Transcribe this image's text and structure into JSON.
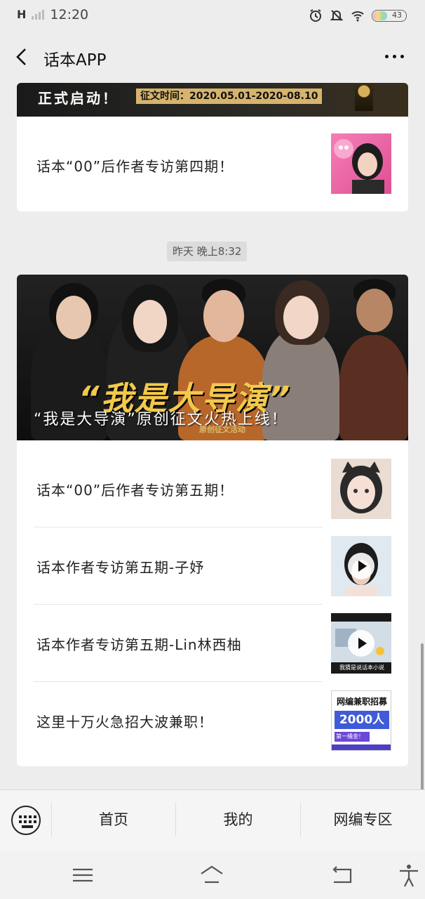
{
  "status_bar": {
    "network": "H",
    "time": "12:20",
    "battery": "43"
  },
  "nav": {
    "title": "话本APP"
  },
  "card1": {
    "banner_left": "正式启动！",
    "banner_right": "征文时间：2020.05.01-2020-08.10",
    "item": "话本“00”后作者专访第四期！"
  },
  "timestamp": "昨天 晚上8:32",
  "card2": {
    "banner_big": "“我是大导演”",
    "banner_caption": "“我是大导演”原创征文火热上线！",
    "banner_sub": "原创征文活动",
    "items": [
      "话本“00”后作者专访第五期！",
      "话本作者专访第五期-子妤",
      "话本作者专访第五期-Lin林西柚",
      "这里十万火急招大波兼职！"
    ],
    "thumb3_caption": "我猜是说话本小说",
    "thumb4_line1": "网编兼职招募",
    "thumb4_line2": "2000人",
    "thumb4_line3": "第一桶金！"
  },
  "menu": {
    "items": [
      "首页",
      "我的",
      "网编专区"
    ]
  },
  "colors": {
    "page_bg": "#ededed",
    "card_bg": "#ffffff",
    "accent_gold": "#d7b46b"
  }
}
